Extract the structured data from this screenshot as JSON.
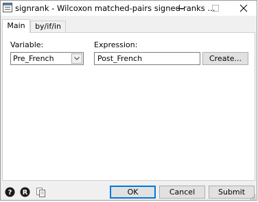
{
  "window": {
    "title": "signrank - Wilcoxon matched-pairs signed-ranks ...",
    "icon": "dialog-app-icon"
  },
  "tabs": [
    {
      "label": "Main",
      "selected": true
    },
    {
      "label": "by/if/in",
      "selected": false
    }
  ],
  "main": {
    "variable_label": "Variable:",
    "variable_value": "Pre_French",
    "expression_label": "Expression:",
    "expression_value": "Post_French",
    "create_button": "Create..."
  },
  "footer": {
    "help_icon": "help-icon",
    "reset_icon": "reset-icon",
    "copy_icon": "copy-command-icon",
    "ok_label": "OK",
    "cancel_label": "Cancel",
    "submit_label": "Submit"
  },
  "colors": {
    "focus_border": "#0078d7",
    "panel_bg": "#ffffff",
    "dialog_bg": "#f0f0f0"
  }
}
